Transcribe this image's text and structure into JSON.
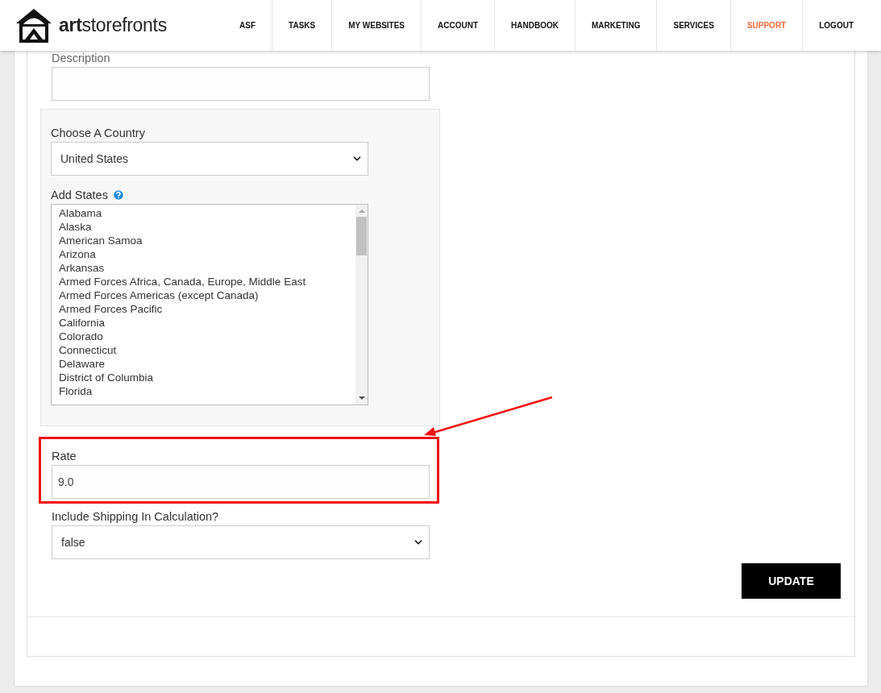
{
  "header": {
    "logo": "**art**storefronts",
    "nav": [
      {
        "label": "ASF",
        "selected": false
      },
      {
        "label": "TASKS",
        "selected": false
      },
      {
        "label": "MY WEBSITES",
        "selected": false
      },
      {
        "label": "ACCOUNT",
        "selected": false
      },
      {
        "label": "HANDBOOK",
        "selected": false
      },
      {
        "label": "MARKETING",
        "selected": false
      },
      {
        "label": "SERVICES",
        "selected": false
      },
      {
        "label": "SUPPORT",
        "selected": true
      },
      {
        "label": "LOGOUT",
        "selected": false
      }
    ]
  },
  "form": {
    "description": {
      "label": "Description"
    },
    "country": {
      "label": "Choose A Country",
      "value": "United States"
    },
    "states": {
      "label": "Add States",
      "options": [
        "Alabama",
        "Alaska",
        "American Samoa",
        "Arizona",
        "Arkansas",
        "Armed Forces Africa, Canada, Europe, Middle East",
        "Armed Forces Americas (except Canada)",
        "Armed Forces Pacific",
        "California",
        "Colorado",
        "Connecticut",
        "Delaware",
        "District of Columbia",
        "Florida"
      ]
    },
    "rate": {
      "label": "Rate",
      "value": "9.0",
      "highlighted": true
    },
    "include_shipping": {
      "label": "Include Shipping In Calculation?",
      "value": "false"
    },
    "submit": "UPDATE"
  }
}
